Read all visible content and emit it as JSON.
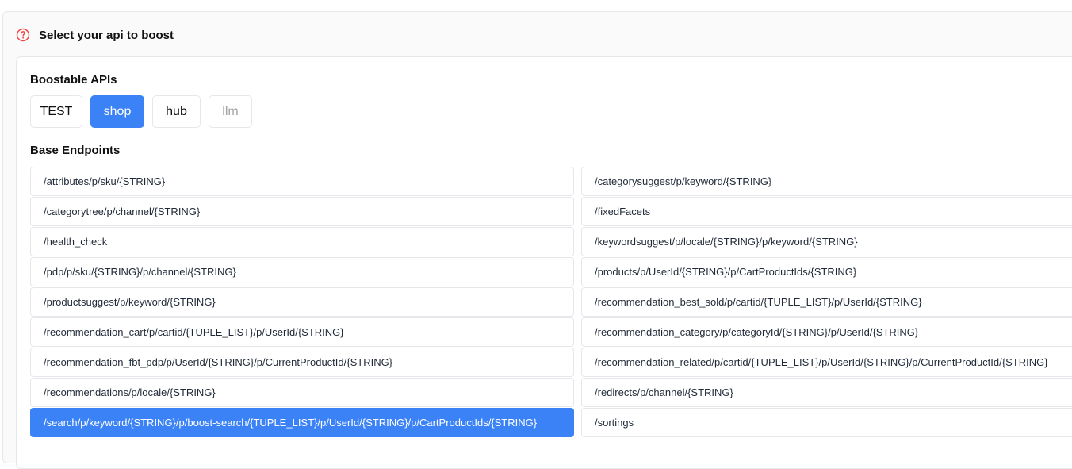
{
  "header": {
    "title": "Select your api to boost",
    "icon": "help-circle-icon",
    "icon_color": "#ef4444"
  },
  "apis": {
    "label": "Boostable APIs",
    "items": [
      {
        "label": "TEST",
        "state": "normal"
      },
      {
        "label": "shop",
        "state": "selected"
      },
      {
        "label": "hub",
        "state": "normal"
      },
      {
        "label": "llm",
        "state": "disabled"
      }
    ]
  },
  "endpoints": {
    "label": "Base Endpoints",
    "selected": "/search/p/keyword/{STRING}/p/boost-search/{TUPLE_LIST}/p/UserId/{STRING}/p/CartProductIds/{STRING}",
    "left": [
      "/attributes/p/sku/{STRING}",
      "/categorytree/p/channel/{STRING}",
      "/health_check",
      "/pdp/p/sku/{STRING}/p/channel/{STRING}",
      "/productsuggest/p/keyword/{STRING}",
      "/recommendation_cart/p/cartid/{TUPLE_LIST}/p/UserId/{STRING}",
      "/recommendation_fbt_pdp/p/UserId/{STRING}/p/CurrentProductId/{STRING}",
      "/recommendations/p/locale/{STRING}",
      "/search/p/keyword/{STRING}/p/boost-search/{TUPLE_LIST}/p/UserId/{STRING}/p/CartProductIds/{STRING}"
    ],
    "right": [
      "/categorysuggest/p/keyword/{STRING}",
      "/fixedFacets",
      "/keywordsuggest/p/locale/{STRING}/p/keyword/{STRING}",
      "/products/p/UserId/{STRING}/p/CartProductIds/{STRING}",
      "/recommendation_best_sold/p/cartid/{TUPLE_LIST}/p/UserId/{STRING}",
      "/recommendation_category/p/categoryId/{STRING}/p/UserId/{STRING}",
      "/recommendation_related/p/cartid/{TUPLE_LIST}/p/UserId/{STRING}/p/CurrentProductId/{STRING}",
      "/redirects/p/channel/{STRING}",
      "/sortings"
    ]
  },
  "colors": {
    "accent": "#3b82f6",
    "border": "#e5e7eb",
    "disabled_text": "#a3a3a3"
  }
}
